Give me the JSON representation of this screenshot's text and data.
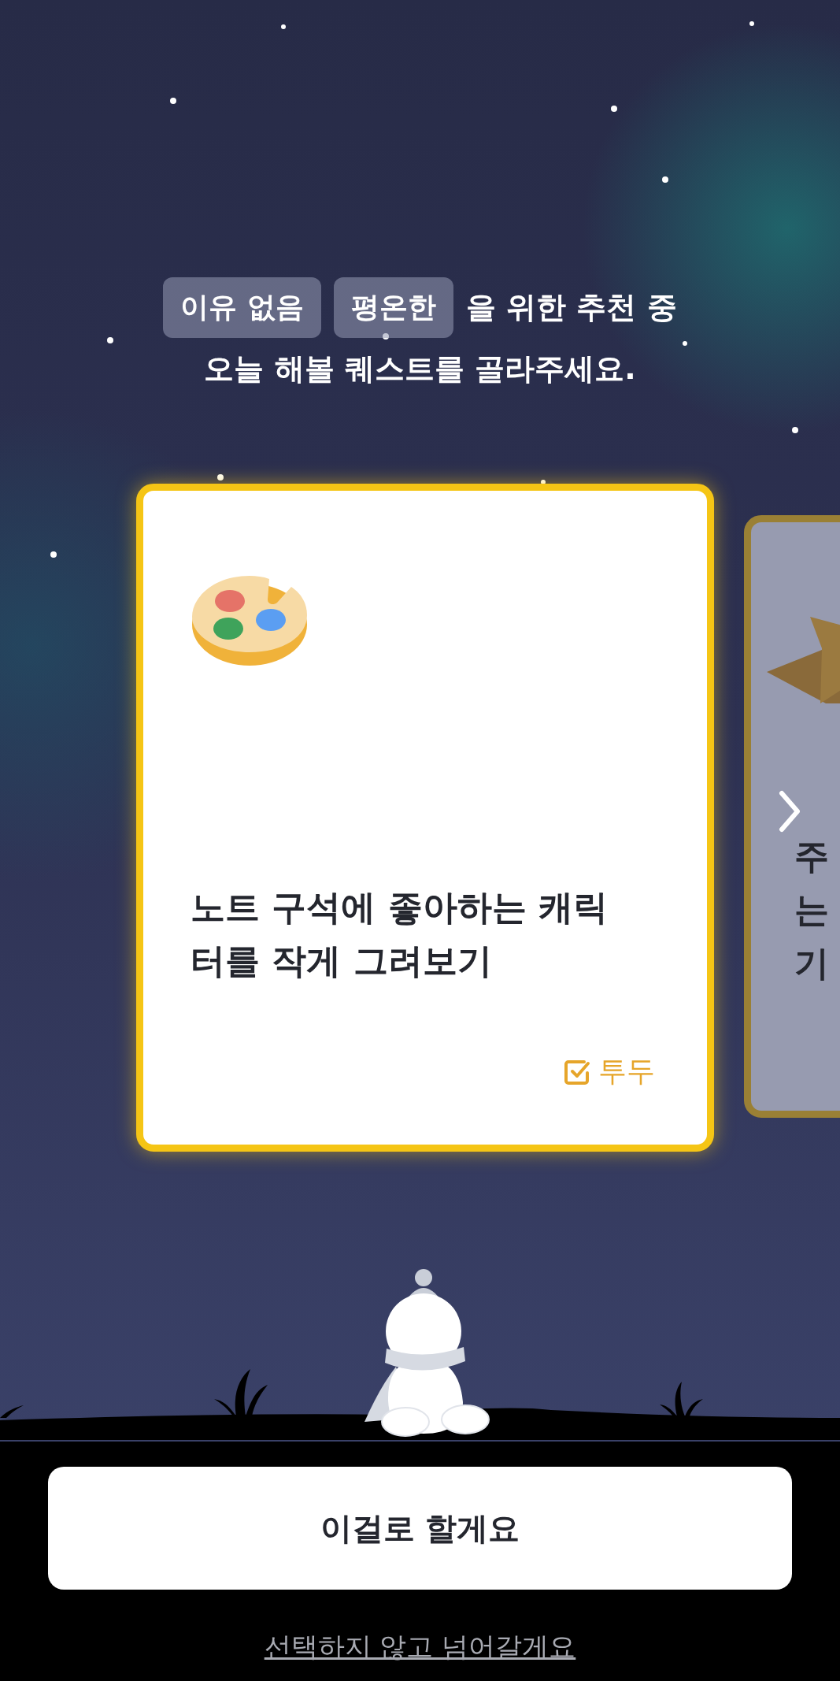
{
  "prompt": {
    "chips": [
      "이유 없음",
      "평온한"
    ],
    "line_1_rest": "을 위한 추천 중",
    "line_2": "오늘 해볼 퀘스트를 골라주세요."
  },
  "quest_cards": [
    {
      "title_lines": [
        "노트 구석에 좋아하는 캐릭",
        "터를 작게 그려보기"
      ],
      "tag": "투두",
      "selected": true
    },
    {
      "title_lines": [
        "주",
        "는",
        "기"
      ],
      "selected": false
    }
  ],
  "confirm_button": "이걸로 할게요",
  "skip_link": "선택하지 않고 넘어갈게요"
}
